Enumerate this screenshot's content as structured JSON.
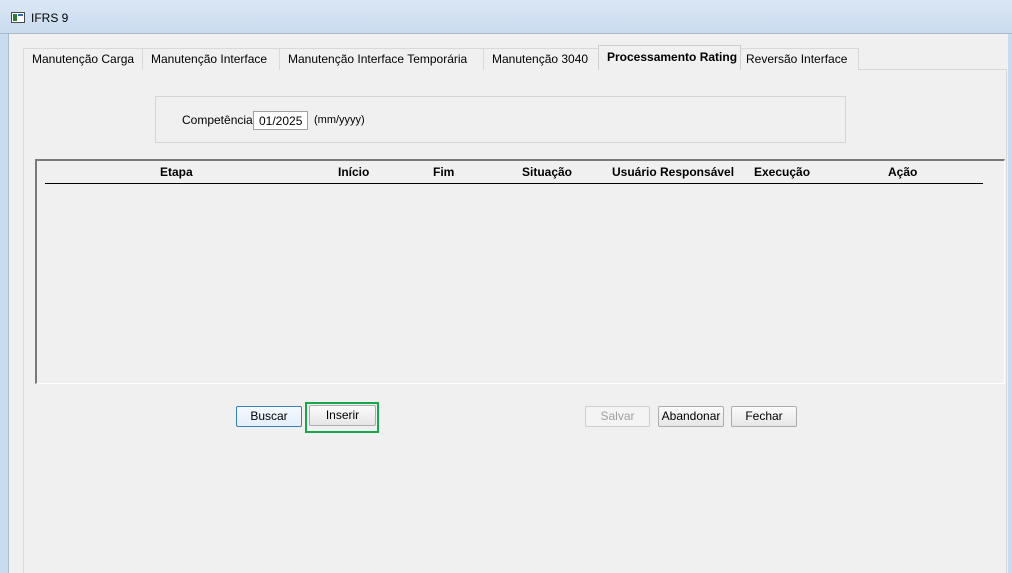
{
  "window": {
    "title": "IFRS 9"
  },
  "tabs": [
    {
      "label": "Manutenção Carga",
      "active": false
    },
    {
      "label": "Manutenção Interface",
      "active": false
    },
    {
      "label": "Manutenção Interface Temporária",
      "active": false
    },
    {
      "label": "Manutenção 3040",
      "active": false
    },
    {
      "label": "Processamento Rating",
      "active": true
    },
    {
      "label": "Reversão Interface",
      "active": false
    }
  ],
  "filter": {
    "competencia_label": "Competência",
    "competencia_value": "01/2025",
    "format_hint": "(mm/yyyy)"
  },
  "grid": {
    "columns": [
      "Etapa",
      "Início",
      "Fim",
      "Situação",
      "Usuário Responsável",
      "Execução",
      "Ação"
    ],
    "rows": []
  },
  "buttons": {
    "buscar": "Buscar",
    "inserir": "Inserir",
    "salvar": "Salvar",
    "abandonar": "Abandonar",
    "fechar": "Fechar"
  },
  "colors": {
    "focus_ring": "#18a84b",
    "default_button_border": "#3c7fb1"
  }
}
